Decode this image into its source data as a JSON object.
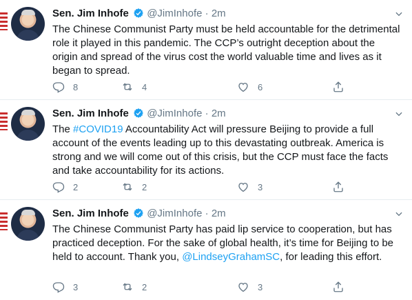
{
  "tweets": [
    {
      "name": "Sen. Jim Inhofe",
      "handle": "@JimInhofe",
      "separator": "·",
      "time": "2m",
      "text_parts": [
        {
          "text": "The Chinese Communist Party must be held accountable for the detrimental role it played in this pandemic. The CCP’s outright deception about the origin and spread of the virus cost the world valuable time and lives as it began to spread.",
          "kind": "plain"
        }
      ],
      "replies": "8",
      "retweets": "4",
      "likes": "6"
    },
    {
      "name": "Sen. Jim Inhofe",
      "handle": "@JimInhofe",
      "separator": "·",
      "time": "2m",
      "text_parts": [
        {
          "text": "The ",
          "kind": "plain"
        },
        {
          "text": "#COVID19",
          "kind": "link"
        },
        {
          "text": " Accountability Act will pressure Beijing to provide a full account of the events leading up to this devastating outbreak. America is strong and we will come out of this crisis, but the CCP must face the facts and take accountability for its actions.",
          "kind": "plain"
        }
      ],
      "replies": "2",
      "retweets": "2",
      "likes": "3"
    },
    {
      "name": "Sen. Jim Inhofe",
      "handle": "@JimInhofe",
      "separator": "·",
      "time": "2m",
      "text_parts": [
        {
          "text": "The Chinese Communist Party has paid lip service to cooperation, but has practiced deception. For the sake of global health, it’s time for Beijing to be held to account. Thank you, ",
          "kind": "plain"
        },
        {
          "text": "@LindseyGrahamSC",
          "kind": "link"
        },
        {
          "text": ", for leading this effort.",
          "kind": "plain"
        }
      ],
      "replies": "3",
      "retweets": "2",
      "likes": "3"
    }
  ],
  "colors": {
    "accent": "#1da1f2",
    "muted": "#657786",
    "text": "#14171a"
  },
  "icons": [
    "verified-badge-icon",
    "chevron-down-icon",
    "reply-icon",
    "retweet-icon",
    "like-icon",
    "share-icon"
  ]
}
